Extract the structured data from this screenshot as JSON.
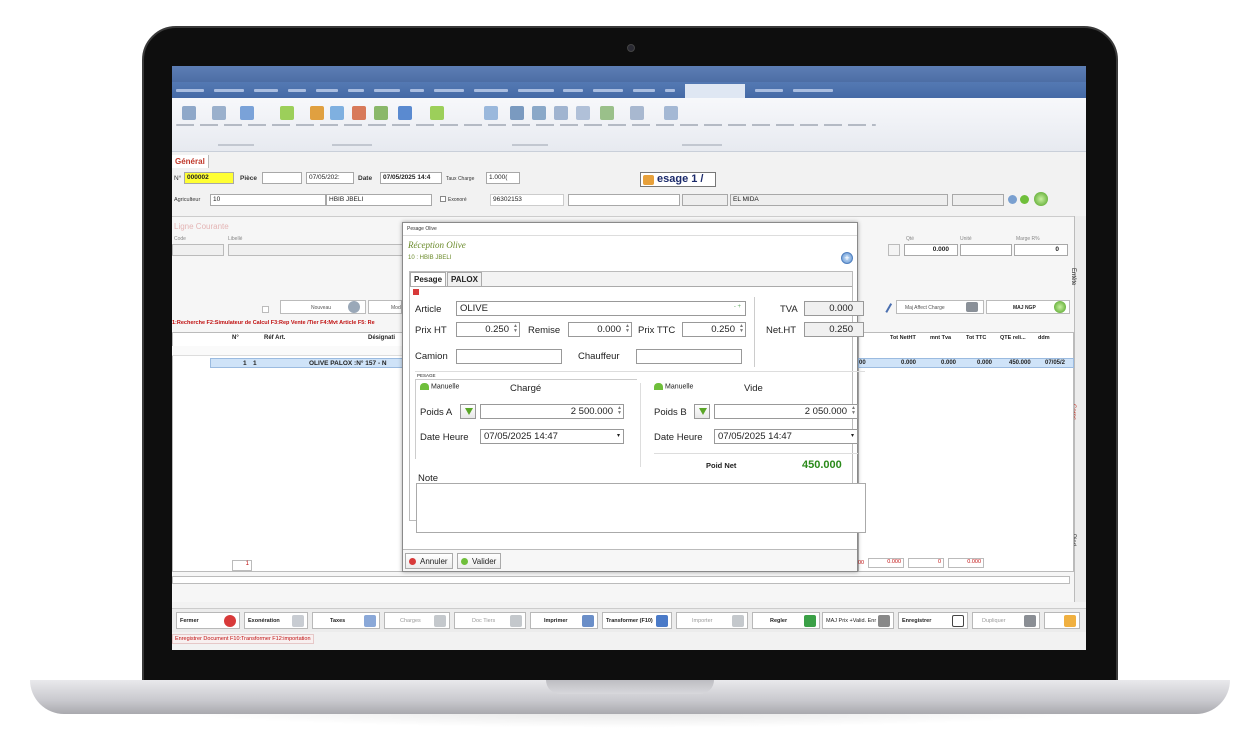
{
  "ribbon": {
    "active_tab": "Pesage d'olive"
  },
  "header": {
    "tab_general": "Général",
    "num_label": "N°",
    "num_value": "000002",
    "piece_label": "Pièce",
    "piece_value": "",
    "piece_date": "07/05/202:",
    "date_label": "Date",
    "date_value": "07/05/2025 14:4",
    "taux_label": "Taux Charge",
    "taux_value": "1.000(",
    "banner": "esage 1 /",
    "agri_label": "Agriculteur",
    "agri_value": "10",
    "agri_name": "HBIB JBELI",
    "exonere_label": "Exonoré",
    "phone": "96302153",
    "city": "EL MIDA"
  },
  "panel": {
    "ligne_courante": "Ligne Courante",
    "code_label": "Code",
    "libelle_label": "Libellé",
    "qte_label": "Qté",
    "qte_value": "0.000",
    "unite_label": "Unité",
    "marge_label": "Marge R%",
    "marge_value": "0",
    "nouveau": "Nouveau",
    "mod": "Mod",
    "maj_affect": "Maj Affect Charge",
    "maj_ngp": "MAJ NGP",
    "hotkeys": "1:Recherche  F2:Simulateur de Calcul  F3:Rep Vente /Tier  F4:Mvt Article  F5: Re",
    "col_n": "N°",
    "col_ref": "Réf Art.",
    "col_designation": "Désignati",
    "row_n": "1",
    "row_ref": "1",
    "row_designation": "OLIVE PALOX :N° 157 - N",
    "right_cols": [
      "Tot NetHT",
      "mnt Tva",
      "Tot TTC",
      "QTE reli...",
      "ddm"
    ],
    "right_vals": [
      "0.000",
      "0.000",
      "0.000",
      "450.000",
      "07/05/2"
    ],
    "right_lead": "00",
    "footer_count": "1",
    "footer_vals": [
      "0.000",
      "0",
      "0.000"
    ],
    "footer_lead": "00"
  },
  "side_tabs": [
    "Entête",
    "Corps",
    "Pied"
  ],
  "bottom_buttons": [
    {
      "label": "Fermer",
      "enabled": true
    },
    {
      "label": "Exonération",
      "enabled": true
    },
    {
      "label": "Taxes",
      "enabled": true
    },
    {
      "label": "Charges",
      "enabled": false
    },
    {
      "label": "Doc Tiers",
      "enabled": false
    },
    {
      "label": "Imprimer",
      "enabled": true
    },
    {
      "label": "Transformer (F10)",
      "enabled": true
    },
    {
      "label": "Importer",
      "enabled": false
    },
    {
      "label": "Regler",
      "enabled": true
    },
    {
      "label": "MAJ Prix +Valid. Enr",
      "enabled": true
    },
    {
      "label": "Enregistrer",
      "enabled": true
    },
    {
      "label": "Dupliquer",
      "enabled": false
    }
  ],
  "status_bar": "Enregistrer Document  F10:Transformer  F12:importation",
  "dialog": {
    "title": "Pesage Olive",
    "reception": "Réception Olive",
    "subtitle": "10 : HBIB JBELI",
    "tab_pesage": "Pesage",
    "tab_palox": "PALOX",
    "article_label": "Article",
    "article_value": "OLIVE",
    "tva_label": "TVA",
    "tva_value": "0.000",
    "prixht_label": "Prix HT",
    "prixht_value": "0.250",
    "remise_label": "Remise",
    "remise_value": "0.000",
    "prixttc_label": "Prix TTC",
    "prixttc_value": "0.250",
    "netht_label": "Net.HT",
    "netht_value": "0.250",
    "camion_label": "Camion",
    "camion_value": "",
    "chauffeur_label": "Chauffeur",
    "chauffeur_value": "",
    "pesage_group": "PESAGE",
    "manuelle": "Manuelle",
    "charge_label": "Chargé",
    "vide_label": "Vide",
    "poids_a_label": "Poids A",
    "poids_a_value": "2 500.000",
    "poids_b_label": "Poids B",
    "poids_b_value": "2 050.000",
    "date_heure_label": "Date Heure",
    "date_a": "07/05/2025 14:47",
    "date_b": "07/05/2025 14:47",
    "poid_net_label": "Poid Net",
    "poid_net_value": "450.000",
    "note_label": "Note",
    "note_value": "",
    "annuler": "Annuler",
    "valider": "Valider"
  },
  "colors": {
    "accent": "#4d6ea5",
    "net_green": "#2a8a1a",
    "hotkey_red": "#c01010"
  }
}
